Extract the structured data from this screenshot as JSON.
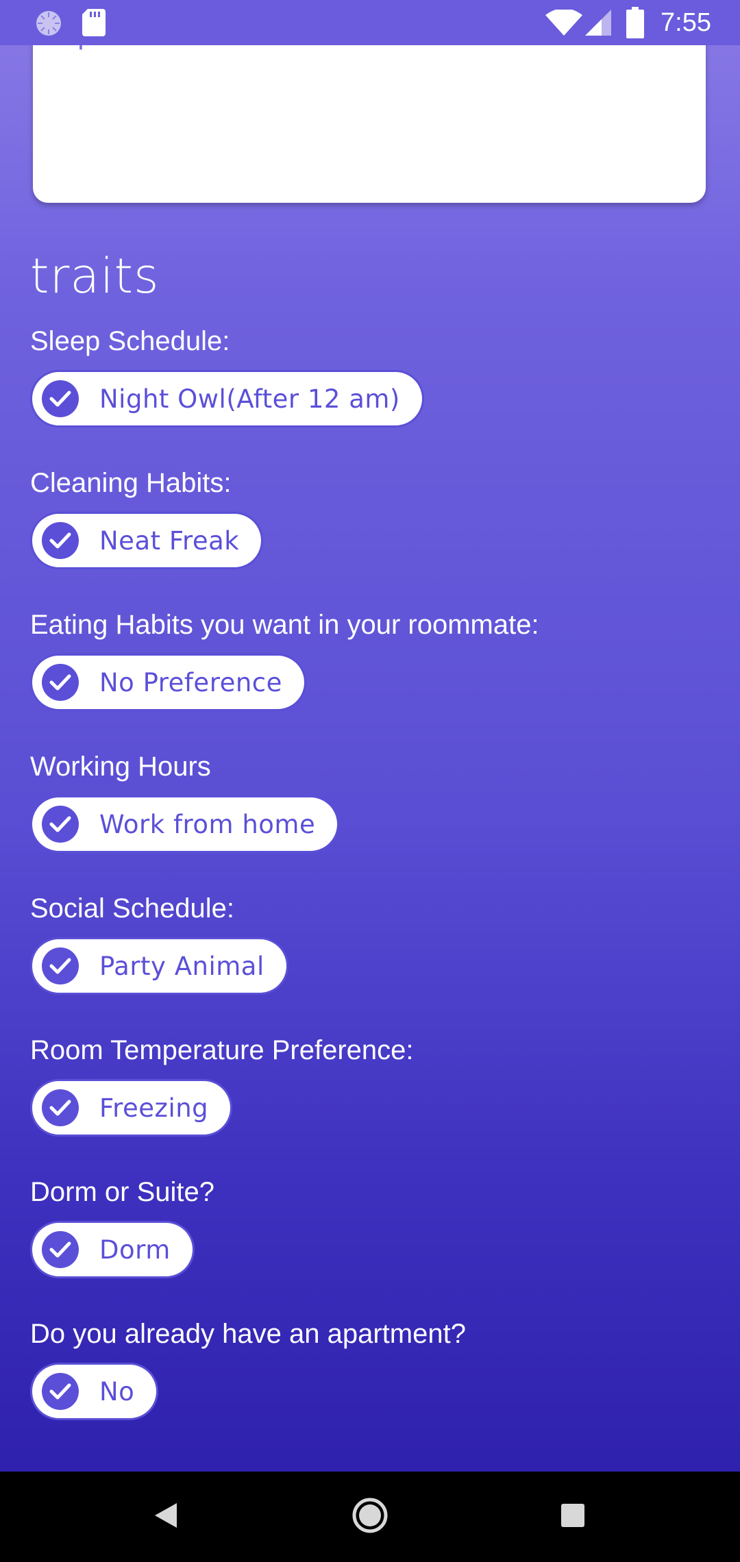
{
  "status_bar": {
    "time": "7:55",
    "left_icons": [
      "loading-circle-icon",
      "sd-card-icon"
    ],
    "right_icons": [
      "wifi-icon",
      "signal-icon",
      "battery-icon"
    ]
  },
  "text_box": {
    "value": "apartment"
  },
  "section": {
    "heading": "traits"
  },
  "traits": [
    {
      "label": "Sleep Schedule:",
      "value": "Night Owl(After 12 am)"
    },
    {
      "label": "Cleaning Habits:",
      "value": "Neat Freak"
    },
    {
      "label": "Eating Habits you want in your roommate:",
      "value": "No Preference"
    },
    {
      "label": "Working Hours",
      "value": "Work from home"
    },
    {
      "label": "Social Schedule:",
      "value": "Party Animal"
    },
    {
      "label": "Room Temperature Preference:",
      "value": "Freezing"
    },
    {
      "label": "Dorm or Suite?",
      "value": "Dorm"
    },
    {
      "label": "Do you already have an apartment?",
      "value": "No"
    }
  ],
  "nav_bar": {
    "icons": [
      "back-icon",
      "home-icon",
      "recents-icon"
    ]
  },
  "colors": {
    "accent": "#5b4fd8",
    "gradient_top": "#8a7ae6",
    "gradient_bottom": "#2e21ad",
    "status_bar": "#6a5cdc"
  }
}
